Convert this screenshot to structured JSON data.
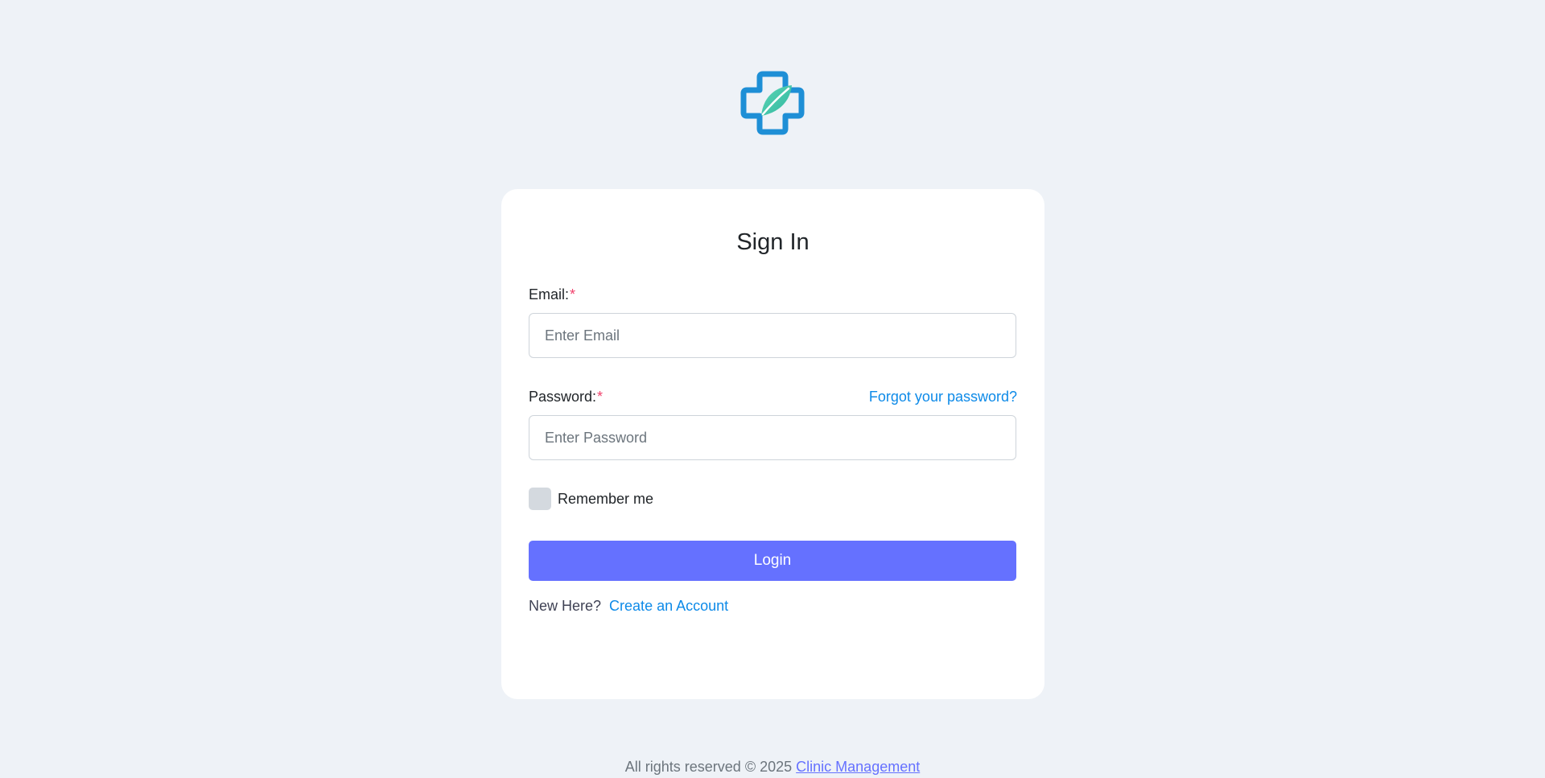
{
  "brand": {
    "logo_icon": "medical-cross-leaf-icon",
    "accent_color": "#6571ff",
    "link_color": "#0d8ae8",
    "required_color": "#f1416c"
  },
  "form": {
    "title": "Sign In",
    "email": {
      "label": "Email:",
      "required_mark": "*",
      "placeholder": "Enter Email",
      "value": ""
    },
    "password": {
      "label": "Password:",
      "required_mark": "*",
      "placeholder": "Enter Password",
      "value": "",
      "forgot_label": "Forgot your password?"
    },
    "remember": {
      "label": "Remember me",
      "checked": false
    },
    "login_label": "Login",
    "signup": {
      "prompt": "New Here?",
      "link_label": "Create an Account"
    }
  },
  "footer": {
    "text": "All rights reserved © 2025",
    "brand_link": "Clinic Management"
  }
}
